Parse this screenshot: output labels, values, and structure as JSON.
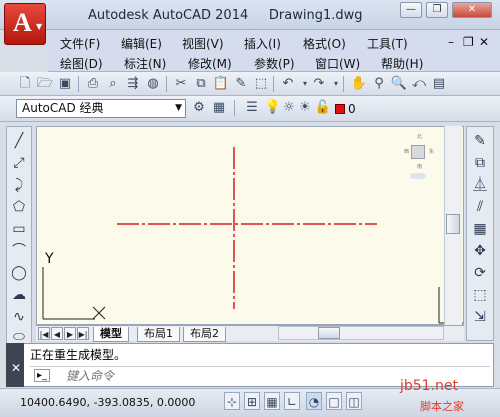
{
  "window": {
    "app_name": "Autodesk AutoCAD 2014",
    "document": "Drawing1.dwg",
    "minimize": "—",
    "restore": "❐",
    "close": "✕"
  },
  "menus": [
    "文件(F)",
    "编辑(E)",
    "视图(V)",
    "插入(I)",
    "格式(O)",
    "工具(T)"
  ],
  "menus2": [
    "绘图(D)",
    "标注(N)",
    "修改(M)",
    "参数(P)",
    "窗口(W)",
    "帮助(H)"
  ],
  "mdi_controls": {
    "min": "–",
    "restore": "❐",
    "close": "✕"
  },
  "workspace": {
    "selected": "AutoCAD 经典"
  },
  "layer": {
    "current": "0",
    "color": "#e01010"
  },
  "canvas": {
    "background": "#fbfaeb",
    "crosshair_color": "#d62020",
    "ucs_y": "Y",
    "ucs_x": "X"
  },
  "viewcube": {
    "north": "北",
    "south": "南",
    "west": "西",
    "east": "东"
  },
  "layout_tabs": [
    "模型",
    "布局1",
    "布局2"
  ],
  "command": {
    "history": "正在重生成模型。",
    "placeholder": "键入命令",
    "prompt_icon": "▸_"
  },
  "status": {
    "coords": "10400.6490, -393.0835, 0.0000"
  },
  "watermark": {
    "line1": "jb51.net",
    "line2": "脚本之家"
  }
}
